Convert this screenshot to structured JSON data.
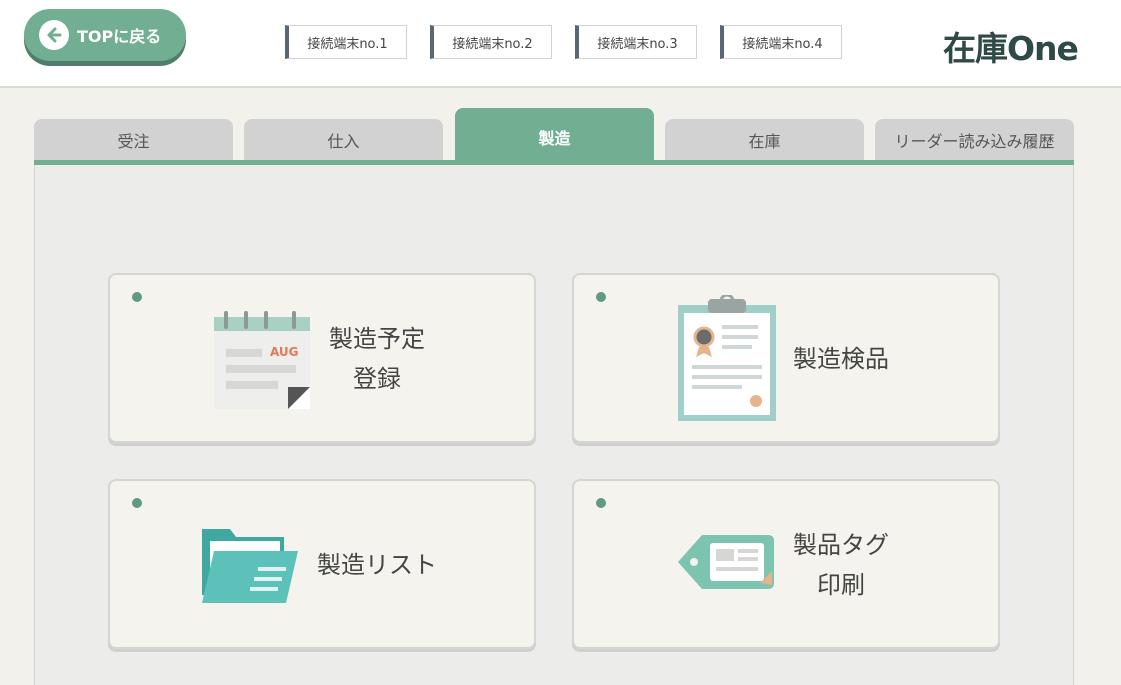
{
  "header": {
    "back_label": "TOPに戻る",
    "terminals": [
      "接続端末no.1",
      "接続端末no.2",
      "接続端末no.3",
      "接続端末no.4"
    ],
    "logo": "在庫One"
  },
  "tabs": [
    {
      "label": "受注",
      "active": false
    },
    {
      "label": "仕入",
      "active": false
    },
    {
      "label": "製造",
      "active": true
    },
    {
      "label": "在庫",
      "active": false
    },
    {
      "label": "リーダー読み込み履歴",
      "active": false
    }
  ],
  "cards": {
    "schedule": {
      "line1": "製造予定",
      "line2": "登録",
      "calendar_month": "AUG"
    },
    "inspection": {
      "label": "製造検品"
    },
    "list": {
      "label": "製造リスト"
    },
    "tag": {
      "line1": "製品タグ",
      "line2": "印刷"
    }
  },
  "colors": {
    "accent": "#72ae92",
    "accent_dark": "#4f7f6a",
    "terminal_bar": "#5a6776",
    "logo": "#2f4a46"
  }
}
